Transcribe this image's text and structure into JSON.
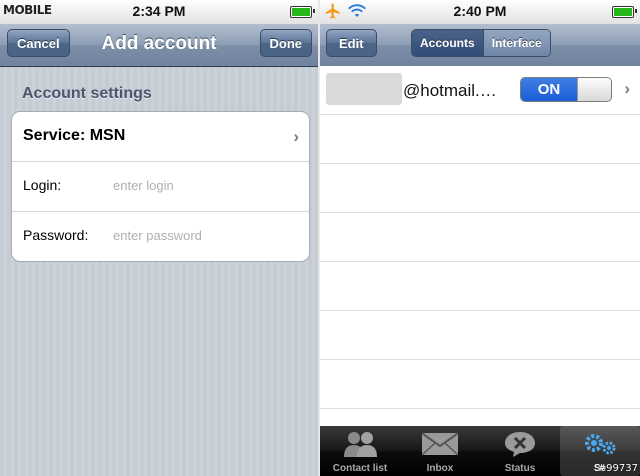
{
  "left": {
    "status": {
      "carrier": "MOBILE",
      "time": "2:34 PM"
    },
    "nav": {
      "cancel": "Cancel",
      "title": "Add account",
      "done": "Done"
    },
    "section_header": "Account settings",
    "service_label": "Service: MSN",
    "login": {
      "label": "Login:",
      "placeholder": "enter login"
    },
    "password": {
      "label": "Password:",
      "placeholder": "enter password"
    }
  },
  "right": {
    "status": {
      "time": "2:40 PM"
    },
    "nav": {
      "edit": "Edit",
      "segments": [
        "Accounts",
        "Interface"
      ],
      "selected": "Accounts"
    },
    "account": {
      "email": "@hotmail.…",
      "toggle": "ON"
    },
    "tabs": [
      "Contact list",
      "Inbox",
      "Status",
      "Se"
    ],
    "watermark": "#99737"
  },
  "icons": [
    "airplane-icon",
    "wifi-icon",
    "battery-icon",
    "chevron-right-icon",
    "contacts-icon",
    "inbox-icon",
    "status-icon",
    "settings-icon"
  ],
  "colors": {
    "nav_bar": "#7e8fa8",
    "toggle_on": "#1a5ed5",
    "battery": "#26b818",
    "airplane": "#f29a1e",
    "wifi": "#2a7cd9"
  }
}
